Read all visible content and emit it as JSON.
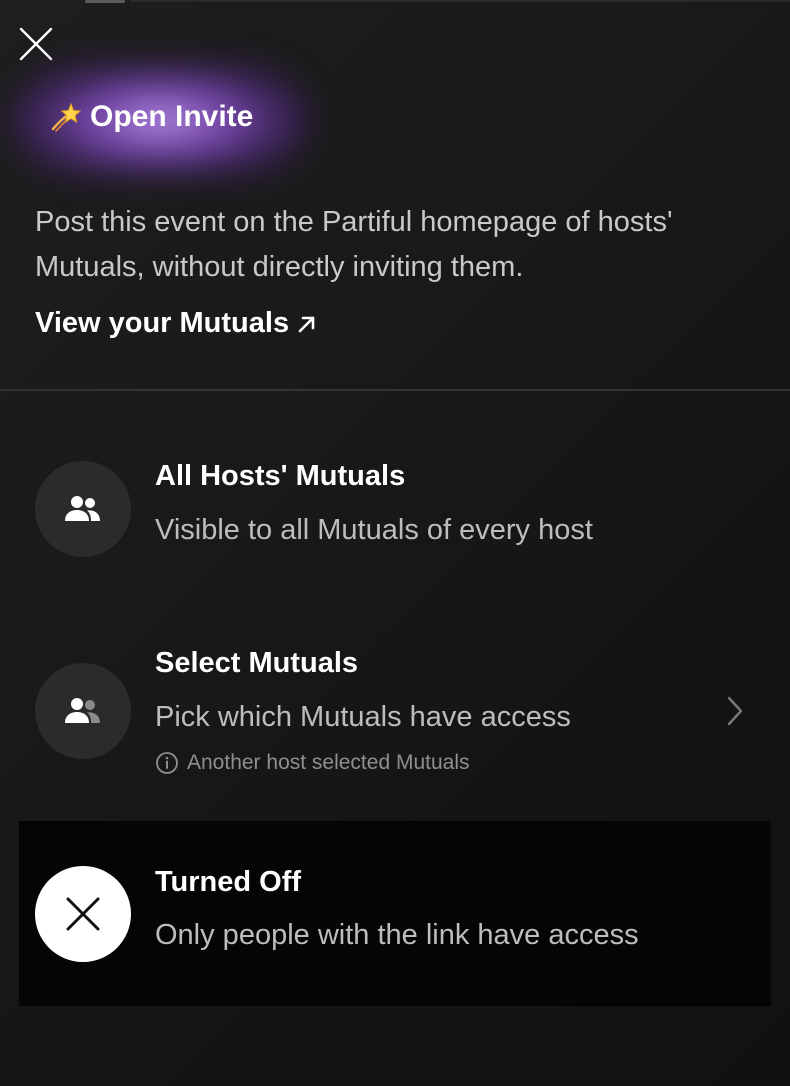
{
  "header": {
    "close_icon": "close-icon",
    "title_emoji": "dizzy-star-emoji",
    "title": "Open Invite",
    "accent_glow": "#8a4fd6"
  },
  "intro": {
    "description": "Post this event on the Partiful homepage of hosts' Mutuals, without directly inviting them.",
    "link_label": "View your Mutuals",
    "link_icon": "arrow-up-right-icon"
  },
  "options": [
    {
      "icon": "users-icon",
      "title": "All Hosts' Mutuals",
      "subtitle": "Visible to all Mutuals of every host",
      "selected": false
    },
    {
      "icon": "users-select-icon",
      "title": "Select Mutuals",
      "subtitle": "Pick which Mutuals have access",
      "note_icon": "info-icon",
      "note": "Another host selected Mutuals",
      "chevron_icon": "chevron-right-icon",
      "selected": false
    },
    {
      "icon": "close-icon",
      "title": "Turned Off",
      "subtitle": "Only people with the link have access",
      "selected": true
    }
  ],
  "colors": {
    "background": "#141414",
    "selected_row": "#050505",
    "icon_circle": "#2b2b2b",
    "selected_icon_circle": "#ffffff",
    "muted_text": "#bdbdbd"
  }
}
